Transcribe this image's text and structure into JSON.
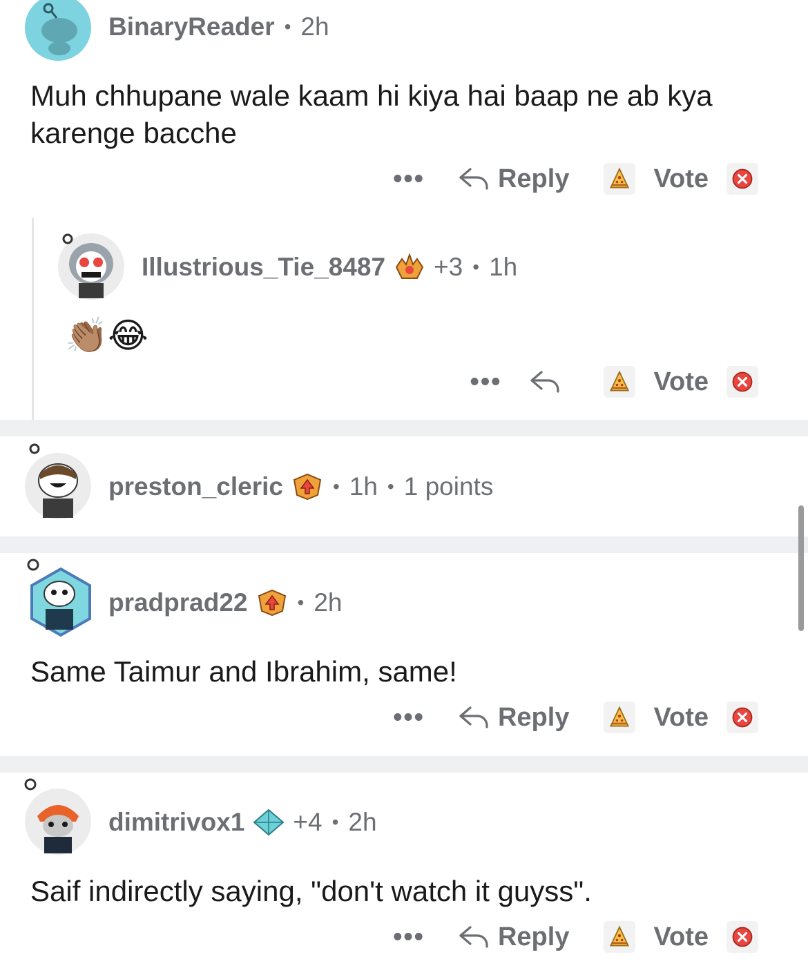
{
  "comments": [
    {
      "username": "BinaryReader",
      "sep1": "•",
      "time": "2h",
      "text": "Muh chhupane wale kaam hi kiya hai baap ne ab kya karenge bacche",
      "actions": {
        "dots": "•••",
        "reply": "Reply",
        "vote": "Vote"
      }
    },
    {
      "username": "Illustrious_Tie_8487",
      "karma": "+3",
      "sep1": "•",
      "time": "1h",
      "text": "👏🏽😂",
      "actions": {
        "dots": "•••",
        "vote": "Vote"
      }
    },
    {
      "username": "preston_cleric",
      "sep1": "•",
      "time": "1h",
      "sep2": "•",
      "points": "1 points"
    },
    {
      "username": "pradprad22",
      "sep1": "•",
      "time": "2h",
      "text": "Same Taimur and Ibrahim, same!",
      "actions": {
        "dots": "•••",
        "reply": "Reply",
        "vote": "Vote"
      }
    },
    {
      "username": "dimitrivox1",
      "karma": "+4",
      "sep1": "•",
      "time": "2h",
      "text": "Saif indirectly saying, \"don't watch it guyss\".",
      "actions": {
        "dots": "•••",
        "reply": "Reply",
        "vote": "Vote"
      }
    }
  ],
  "colors": {
    "divider": "#eff0f1",
    "username": "#6b6e73",
    "text": "#1a1a1b",
    "downvote": "#e8463f",
    "upvote": "#f5c342"
  },
  "icons": [
    "reply-arrow-icon",
    "upvote-pizza-icon",
    "downvote-x-icon",
    "more-dots-icon",
    "flair-badge-icon"
  ]
}
